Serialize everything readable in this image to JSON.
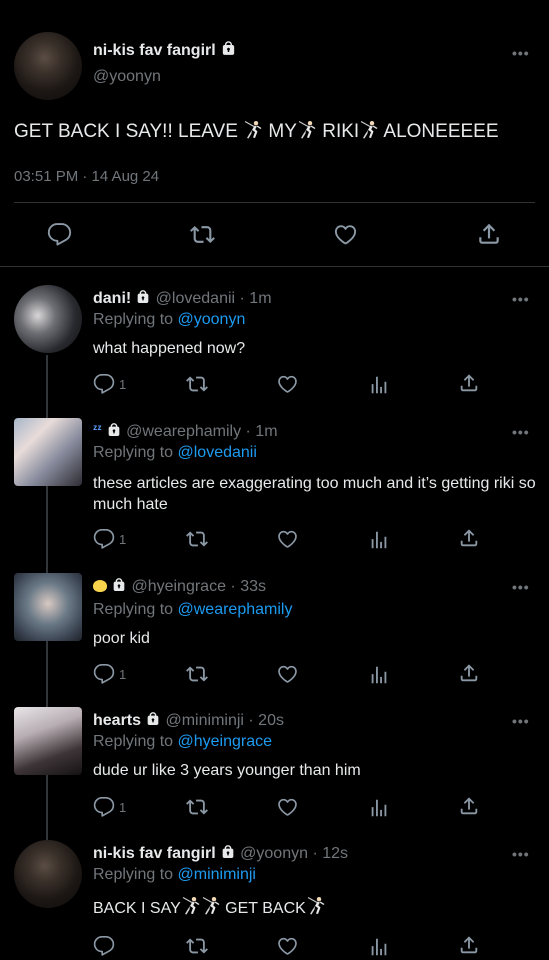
{
  "main_tweet": {
    "name": "ni-kis fav fangirl",
    "handle": "@yoonyn",
    "text_parts": [
      "GET BACK I SAY!! LEAVE ",
      " MY",
      " RIKI",
      " ALONEEEEE"
    ],
    "timestamp": "03:51 PM · 14 Aug 24"
  },
  "replies": [
    {
      "name": "dani!",
      "handle": "@lovedanii",
      "time": " · 1m",
      "replying_prefix": "Replying to ",
      "replying_to": "@yoonyn",
      "text": "what happened now?",
      "reply_count": "1"
    },
    {
      "name": "",
      "handle": "@wearephamily",
      "time": " · 1m",
      "replying_prefix": "Replying to ",
      "replying_to": "@lovedanii",
      "text": "these articles are exaggerating too much and it’s getting riki so much hate",
      "reply_count": "1"
    },
    {
      "name": "",
      "handle": "@hyeingrace",
      "time": " · 33s",
      "replying_prefix": "Replying to ",
      "replying_to": "@wearephamily",
      "text": "poor kid",
      "reply_count": "1"
    },
    {
      "name": "hearts",
      "handle": "@miniminji",
      "time": " · 20s",
      "replying_prefix": "Replying to ",
      "replying_to": "@hyeingrace",
      "text": "dude ur like 3 years younger than him",
      "reply_count": "1"
    },
    {
      "name": "ni-kis fav fangirl",
      "handle": "@yoonyn",
      "time": " · 12s",
      "replying_prefix": "Replying to ",
      "replying_to": "@miniminji",
      "text_parts": [
        "BACK I SAY",
        " GET BACK"
      ],
      "reply_count": ""
    }
  ],
  "colors": {
    "background": "#000000",
    "text": "#e7e9ea",
    "muted": "#71767b",
    "link": "#1d9bf0",
    "divider": "#2f3336"
  },
  "icons": [
    "lock-icon",
    "more-icon",
    "reply-icon",
    "retweet-icon",
    "like-icon",
    "share-icon",
    "views-icon",
    "fencer-emoji",
    "zzz-emoji",
    "chick-emoji"
  ]
}
